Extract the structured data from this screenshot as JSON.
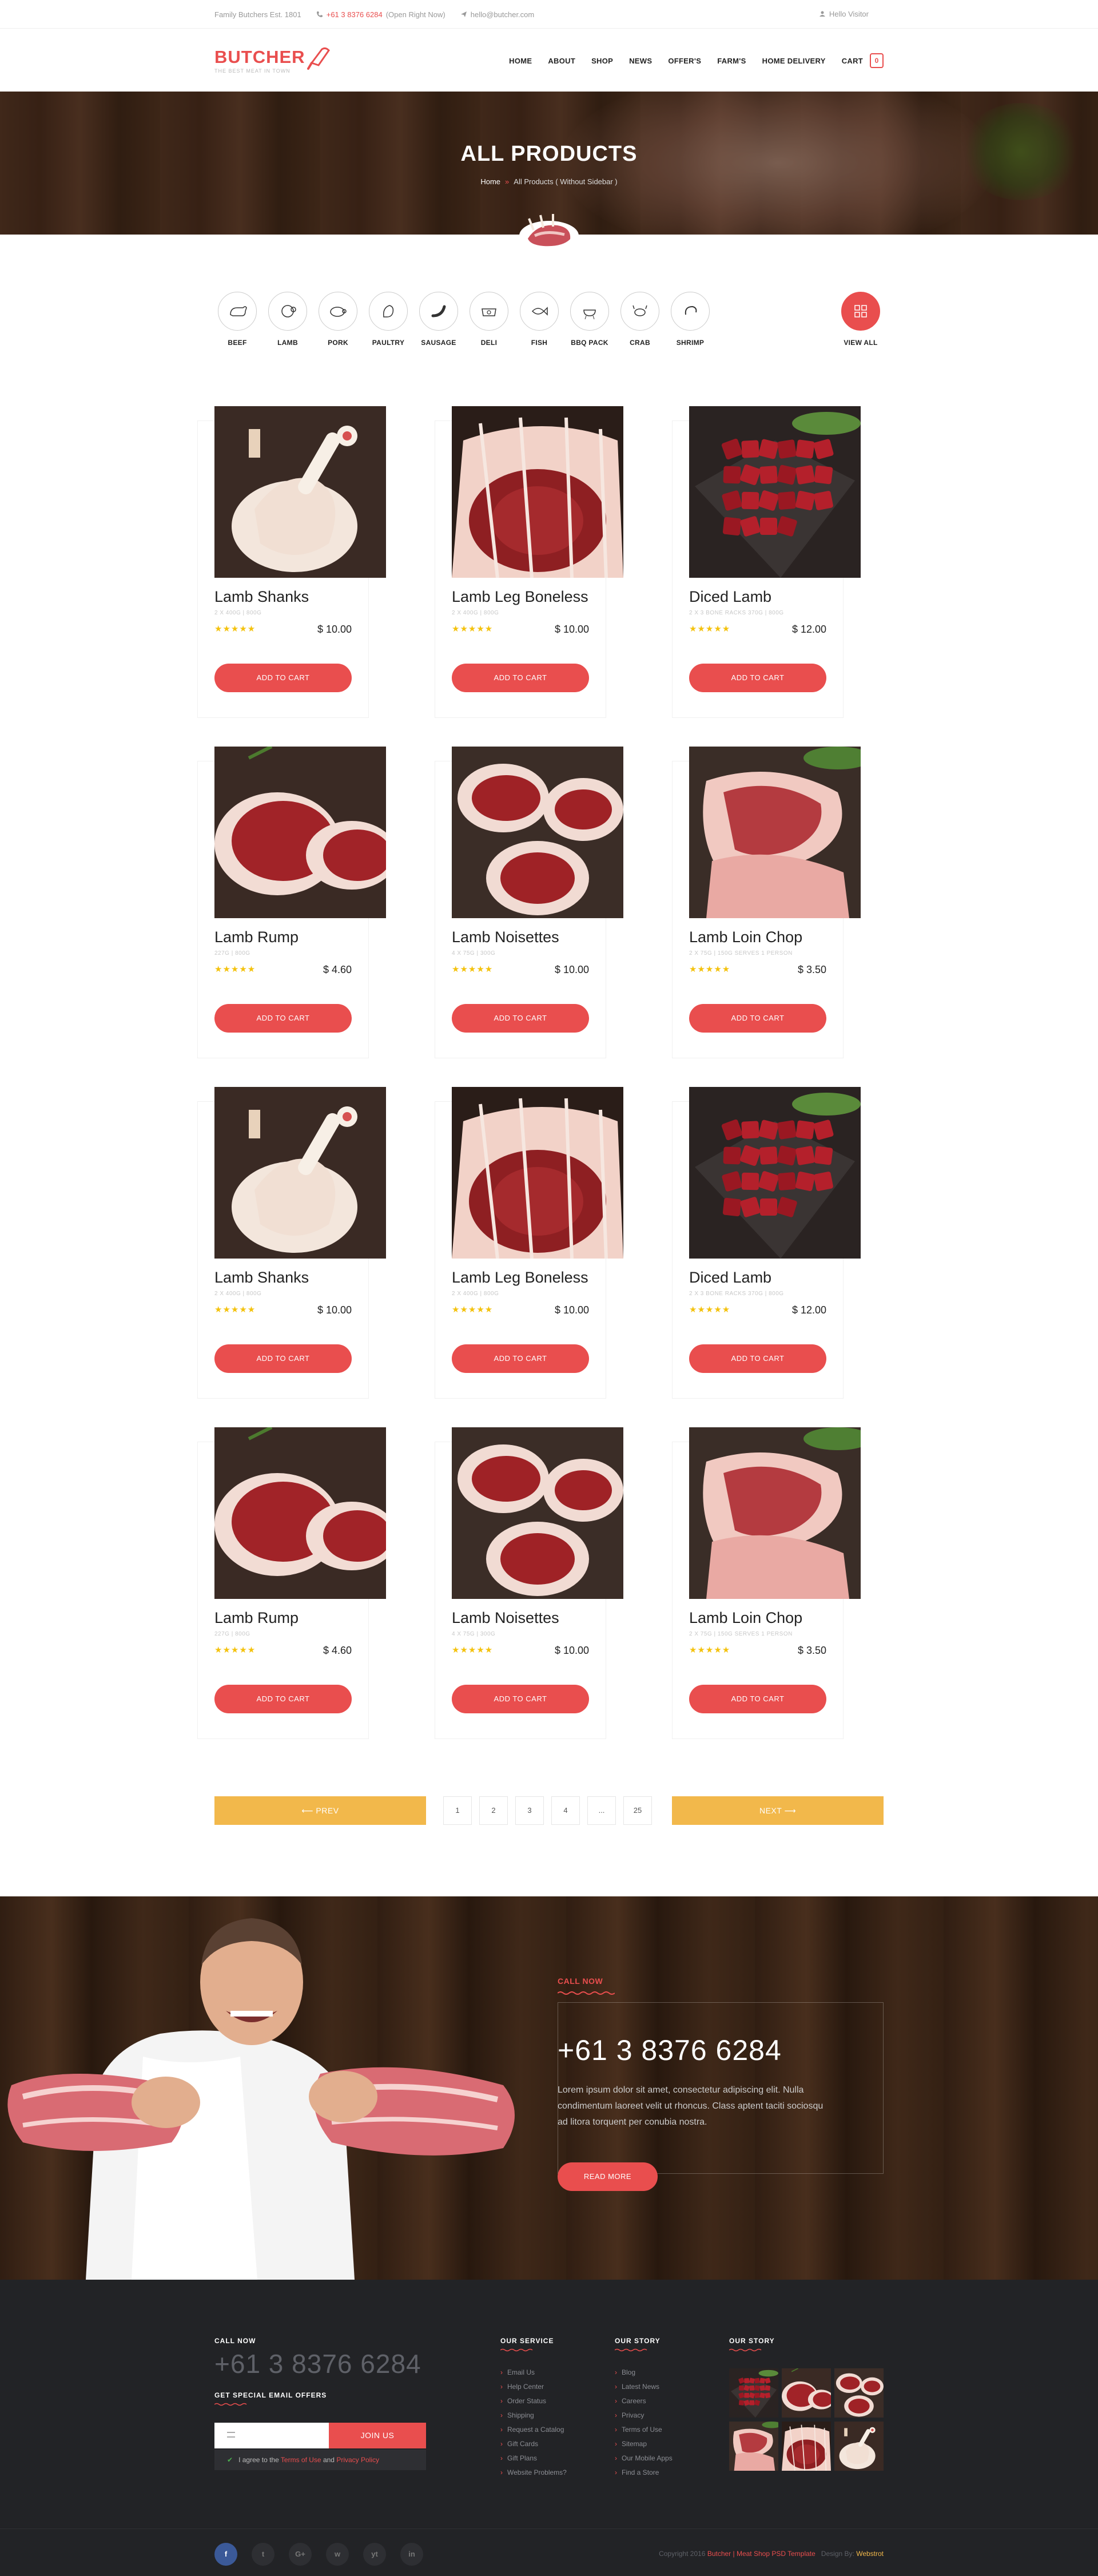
{
  "topbar": {
    "family": "Family Butchers Est. 1801",
    "phone": "+61 3 8376 6284",
    "open": "(Open Right Now)",
    "email": "hello@butcher.com",
    "hello": "Hello Visitor"
  },
  "logo": {
    "name": "BUTCHER",
    "tagline": "THE BEST MEAT IN TOWN"
  },
  "nav": {
    "items": [
      "HOME",
      "ABOUT",
      "SHOP",
      "NEWS",
      "OFFER'S",
      "FARM'S",
      "HOME DELIVERY",
      "CART"
    ],
    "cart_count": "0"
  },
  "hero": {
    "title": "ALL PRODUCTS",
    "breadcrumb_home": "Home",
    "breadcrumb_current": "All Products ( Without Sidebar )"
  },
  "categories": {
    "items": [
      "BEEF",
      "LAMB",
      "PORK",
      "PAULTRY",
      "SAUSAGE",
      "DELI",
      "FISH",
      "BBQ PACK",
      "CRAB",
      "SHRIMP"
    ],
    "view_all": "VIEW ALL"
  },
  "products": [
    {
      "name": "Lamb Shanks",
      "sub": "2 X 400G | 800G",
      "price": "$ 10.00",
      "rating": 5,
      "button": "ADD TO CART",
      "image": "shank"
    },
    {
      "name": "Lamb Leg Boneless",
      "sub": "2 X 400G | 800G",
      "price": "$ 10.00",
      "rating": 5,
      "button": "ADD TO CART",
      "image": "leg"
    },
    {
      "name": "Diced Lamb",
      "sub": "2 X 3 BONE RACKS 370G | 800G",
      "price": "$ 12.00",
      "rating": 5,
      "button": "ADD TO CART",
      "image": "diced"
    },
    {
      "name": "Lamb Rump",
      "sub": "227G | 800G",
      "price": "$ 4.60",
      "rating": 5,
      "button": "ADD TO CART",
      "image": "rump"
    },
    {
      "name": "Lamb Noisettes",
      "sub": "4 X 75G | 300G",
      "price": "$ 10.00",
      "rating": 5,
      "button": "ADD TO CART",
      "image": "noisette"
    },
    {
      "name": "Lamb Loin Chop",
      "sub": "2 X 75G | 150G SERVES 1 PERSON",
      "price": "$ 3.50",
      "rating": 5,
      "button": "ADD TO CART",
      "image": "loin"
    },
    {
      "name": "Lamb Shanks",
      "sub": "2 X 400G | 800G",
      "price": "$ 10.00",
      "rating": 5,
      "button": "ADD TO CART",
      "image": "shank"
    },
    {
      "name": "Lamb Leg Boneless",
      "sub": "2 X 400G | 800G",
      "price": "$ 10.00",
      "rating": 5,
      "button": "ADD TO CART",
      "image": "leg"
    },
    {
      "name": "Diced Lamb",
      "sub": "2 X 3 BONE RACKS 370G | 800G",
      "price": "$ 12.00",
      "rating": 5,
      "button": "ADD TO CART",
      "image": "diced"
    },
    {
      "name": "Lamb Rump",
      "sub": "227G | 800G",
      "price": "$ 4.60",
      "rating": 5,
      "button": "ADD TO CART",
      "image": "rump"
    },
    {
      "name": "Lamb Noisettes",
      "sub": "4 X 75G | 300G",
      "price": "$ 10.00",
      "rating": 5,
      "button": "ADD TO CART",
      "image": "noisette"
    },
    {
      "name": "Lamb Loin Chop",
      "sub": "2 X 75G | 150G SERVES 1 PERSON",
      "price": "$ 3.50",
      "rating": 5,
      "button": "ADD TO CART",
      "image": "loin"
    }
  ],
  "pagination": {
    "prev": "PREV",
    "next": "NEXT",
    "pages": [
      "1",
      "2",
      "3",
      "4",
      "...",
      "25"
    ]
  },
  "callnow": {
    "label": "CALL NOW",
    "phone": "+61 3 8376 6284",
    "text": "Lorem ipsum dolor sit amet, consectetur adipiscing elit. Nulla condimentum laoreet velit ut rhoncus. Class aptent taciti sociosqu ad litora torquent per conubia nostra.",
    "button": "READ MORE"
  },
  "footer": {
    "call_label": "CALL NOW",
    "phone": "+61 3 8376 6284",
    "email_label": "GET SPECIAL EMAIL OFFERS",
    "join": "JOIN US",
    "agree_prefix": "I agree to the",
    "terms": "Terms of Use",
    "and": "and",
    "privacy": "Privacy Policy",
    "service_title": "OUR SERVICE",
    "service": [
      "Email Us",
      "Help Center",
      "Order Status",
      "Shipping",
      "Request a Catalog",
      "Gift Cards",
      "Gift Plans",
      "Website Problems?"
    ],
    "story_title": "OUR STORY",
    "story": [
      "Blog",
      "Latest News",
      "Careers",
      "Privacy",
      "Terms of Use",
      "Sitemap",
      "Our Mobile Apps",
      "Find a Store"
    ],
    "story2_title": "OUR STORY",
    "social": [
      "f",
      "t",
      "G+",
      "w",
      "yt",
      "in"
    ],
    "copyright": "Copyright 2016",
    "brand": "Butcher | Meat Shop PSD Template",
    "design_by": "Design By:",
    "designer": "Webstrot"
  },
  "colors": {
    "accent": "#e94e4e",
    "yellow": "#f2b84b",
    "star": "#f4c20d",
    "footer_bg": "#222326"
  }
}
